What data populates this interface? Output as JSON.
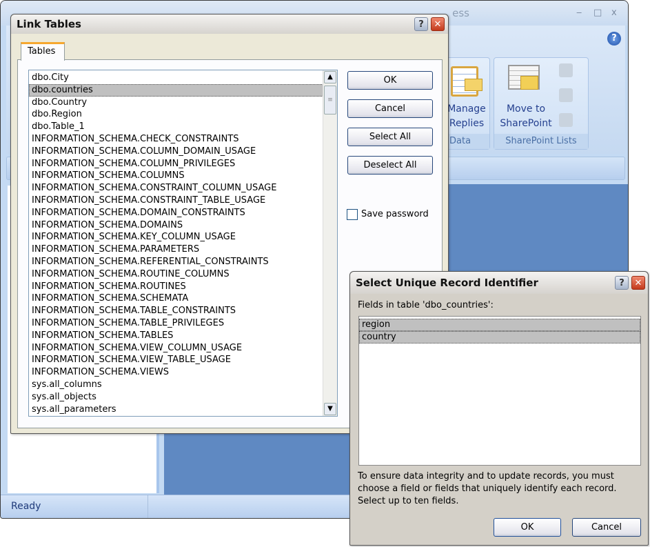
{
  "app": {
    "title_fragment": "ess",
    "window_controls": {
      "minimize": "‒",
      "maximize": "□",
      "close": "x"
    },
    "help_icon": "?",
    "ribbon": {
      "groups": [
        {
          "label": "Data",
          "buttons": [
            {
              "label_line1": "Manage",
              "label_line2": "Replies",
              "icon": "clipboard-mail-icon"
            }
          ]
        },
        {
          "label": "SharePoint Lists",
          "buttons": [
            {
              "label_line1": "Move to",
              "label_line2": "SharePoint",
              "icon": "table-folder-icon"
            }
          ],
          "small_icons": [
            "sync-icon",
            "table-refresh-icon",
            "discard-changes-icon"
          ]
        }
      ]
    },
    "status": "Ready",
    "accent": "#5f89c2"
  },
  "link_tables": {
    "title": "Link Tables",
    "tab": "Tables",
    "items": [
      "dbo.City",
      "dbo.countries",
      "dbo.Country",
      "dbo.Region",
      "dbo.Table_1",
      "INFORMATION_SCHEMA.CHECK_CONSTRAINTS",
      "INFORMATION_SCHEMA.COLUMN_DOMAIN_USAGE",
      "INFORMATION_SCHEMA.COLUMN_PRIVILEGES",
      "INFORMATION_SCHEMA.COLUMNS",
      "INFORMATION_SCHEMA.CONSTRAINT_COLUMN_USAGE",
      "INFORMATION_SCHEMA.CONSTRAINT_TABLE_USAGE",
      "INFORMATION_SCHEMA.DOMAIN_CONSTRAINTS",
      "INFORMATION_SCHEMA.DOMAINS",
      "INFORMATION_SCHEMA.KEY_COLUMN_USAGE",
      "INFORMATION_SCHEMA.PARAMETERS",
      "INFORMATION_SCHEMA.REFERENTIAL_CONSTRAINTS",
      "INFORMATION_SCHEMA.ROUTINE_COLUMNS",
      "INFORMATION_SCHEMA.ROUTINES",
      "INFORMATION_SCHEMA.SCHEMATA",
      "INFORMATION_SCHEMA.TABLE_CONSTRAINTS",
      "INFORMATION_SCHEMA.TABLE_PRIVILEGES",
      "INFORMATION_SCHEMA.TABLES",
      "INFORMATION_SCHEMA.VIEW_COLUMN_USAGE",
      "INFORMATION_SCHEMA.VIEW_TABLE_USAGE",
      "INFORMATION_SCHEMA.VIEWS",
      "sys.all_columns",
      "sys.all_objects",
      "sys.all_parameters"
    ],
    "selected": "dbo.countries",
    "buttons": {
      "ok": "OK",
      "cancel": "Cancel",
      "select_all": "Select All",
      "deselect_all": "Deselect All"
    },
    "save_password": {
      "label": "Save password",
      "checked": false
    },
    "help": "?",
    "close": "✕"
  },
  "unique_id": {
    "title": "Select Unique Record Identifier",
    "fields_label": "Fields in table 'dbo_countries':",
    "fields": [
      "region",
      "country"
    ],
    "selected": [
      "region",
      "country"
    ],
    "info": "To ensure data integrity and to update records, you must choose a field or fields that uniquely identify each record. Select up to ten fields.",
    "buttons": {
      "ok": "OK",
      "cancel": "Cancel"
    },
    "help": "?",
    "close": "✕"
  }
}
